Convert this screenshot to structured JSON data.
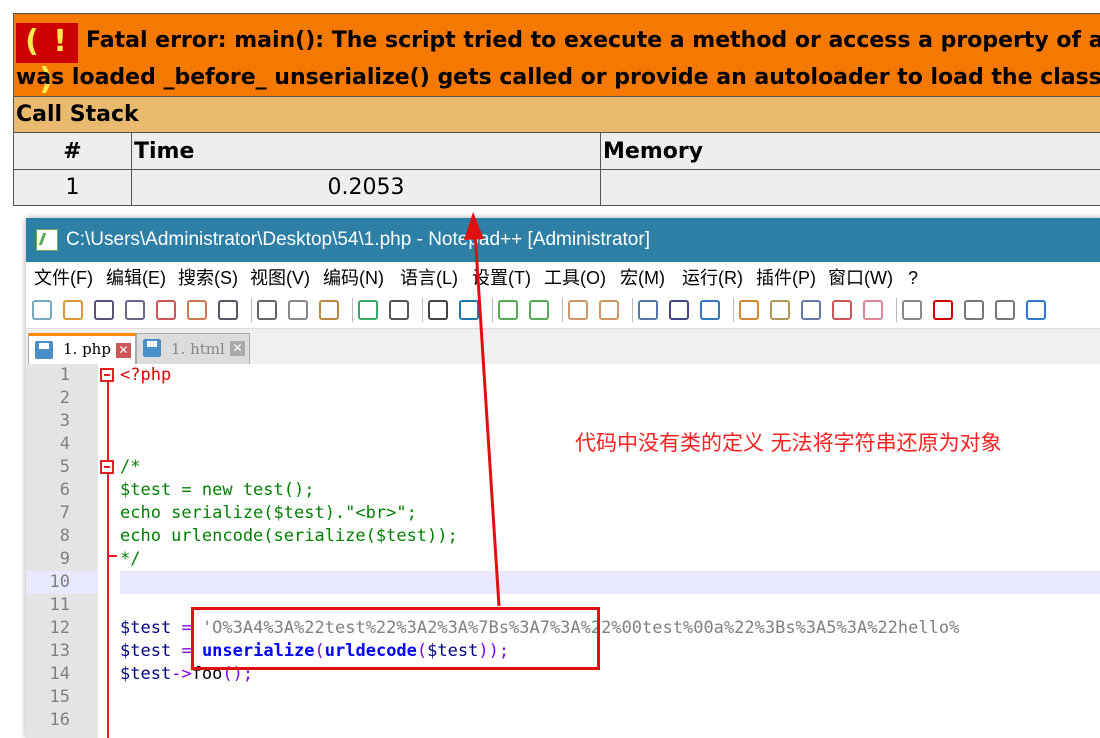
{
  "error": {
    "icon_text": "( ! )",
    "line1": "Fatal error: main(): The script tried to execute a method or access a property of an in",
    "line2": "was loaded _before_ unserialize() gets called or provide an autoloader to load the class de",
    "callstack_label": "Call Stack",
    "columns": [
      "#",
      "Time",
      "Memory"
    ],
    "rows": [
      {
        "num": "1",
        "time": "0.2053",
        "memory": ""
      }
    ],
    "colors": {
      "header_bg": "#f57900",
      "callstack_bg": "#e9b96e",
      "row_bg": "#eeeeec",
      "icon_bg": "#cc0000",
      "icon_fg": "#fce94f"
    }
  },
  "window": {
    "title": "C:\\Users\\Administrator\\Desktop\\54\\1.php - Notepad++ [Administrator]",
    "title_bg": "#2e7fa6",
    "menu": [
      "文件(F)",
      "编辑(E)",
      "搜索(S)",
      "视图(V)",
      "编码(N)",
      "语言(L)",
      "设置(T)",
      "工具(O)",
      "宏(M)",
      "运行(R)",
      "插件(P)",
      "窗口(W)",
      "?"
    ],
    "tabs": [
      {
        "label": "1. php",
        "active": true
      },
      {
        "label": "1. html",
        "active": false
      }
    ],
    "toolbar_icons": [
      "new-file-icon",
      "open-file-icon",
      "save-icon",
      "save-all-icon",
      "close-icon",
      "close-all-icon",
      "print-icon",
      "cut-icon",
      "copy-icon",
      "paste-icon",
      "undo-icon",
      "redo-icon",
      "find-icon",
      "replace-icon",
      "zoom-in-icon",
      "zoom-out-icon",
      "sync-v-icon",
      "sync-h-icon",
      "word-wrap-icon",
      "show-all-chars-icon",
      "indent-guide-icon",
      "udl-icon",
      "doc-map-icon",
      "function-list-icon",
      "folder-workspace-icon",
      "monitor-icon",
      "record-macro-icon",
      "stop-macro-icon",
      "play-macro-icon",
      "run-macro-multi-icon",
      "save-macro-icon"
    ]
  },
  "code": {
    "lines": [
      {
        "n": "1",
        "parts": [
          [
            "k-php",
            "<?php"
          ]
        ]
      },
      {
        "n": "2",
        "parts": []
      },
      {
        "n": "3",
        "parts": []
      },
      {
        "n": "4",
        "parts": []
      },
      {
        "n": "5",
        "parts": [
          [
            "k-cmt",
            "/*"
          ]
        ]
      },
      {
        "n": "6",
        "parts": [
          [
            "k-cmt",
            "$test = new test();"
          ]
        ]
      },
      {
        "n": "7",
        "parts": [
          [
            "k-cmt",
            "echo serialize($test).\"<br>\";"
          ]
        ]
      },
      {
        "n": "8",
        "parts": [
          [
            "k-cmt",
            "echo urlencode(serialize($test));"
          ]
        ]
      },
      {
        "n": "9",
        "parts": [
          [
            "k-cmt",
            "*/"
          ]
        ]
      },
      {
        "n": "10",
        "parts": [],
        "current": true
      },
      {
        "n": "11",
        "parts": []
      },
      {
        "n": "12",
        "parts": [
          [
            "k-var",
            "$test"
          ],
          [
            "k-plain",
            " "
          ],
          [
            "k-op",
            "="
          ],
          [
            "k-plain",
            " "
          ],
          [
            "k-str",
            "'O%3A4%3A%22test%22%3A2%3A%7Bs%3A7%3A%22%00test%00a%22%3Bs%3A5%3A%22hello%"
          ]
        ]
      },
      {
        "n": "13",
        "parts": [
          [
            "k-var",
            "$test"
          ],
          [
            "k-plain",
            " "
          ],
          [
            "k-op",
            "="
          ],
          [
            "k-plain",
            " "
          ],
          [
            "k-fn",
            "unserialize"
          ],
          [
            "k-op",
            "("
          ],
          [
            "k-fn",
            "urldecode"
          ],
          [
            "k-op",
            "("
          ],
          [
            "k-var",
            "$test"
          ],
          [
            "k-op",
            "));"
          ]
        ]
      },
      {
        "n": "14",
        "parts": [
          [
            "k-var",
            "$test"
          ],
          [
            "k-op",
            "->"
          ],
          [
            "k-plain",
            "foo"
          ],
          [
            "k-op",
            "();"
          ]
        ]
      },
      {
        "n": "15",
        "parts": []
      },
      {
        "n": "16",
        "parts": []
      }
    ]
  },
  "annotation": {
    "text": "代码中没有类的定义 无法将字符串还原为对象",
    "color": "#ff2020"
  }
}
